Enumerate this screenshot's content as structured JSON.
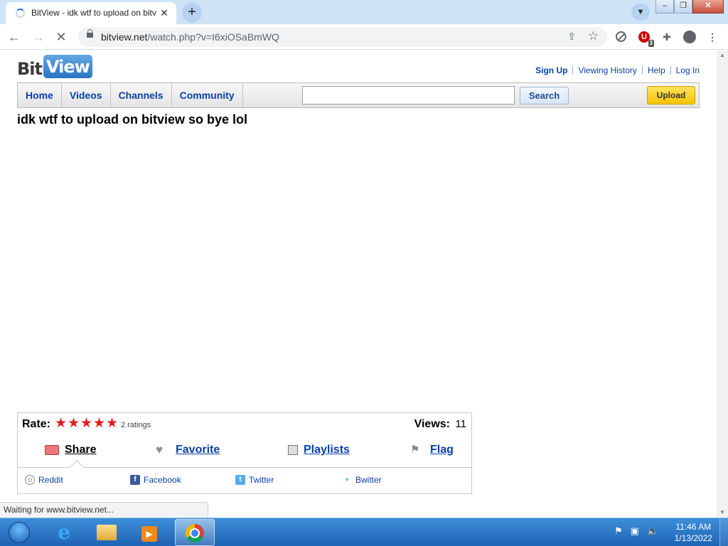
{
  "browser": {
    "tab_title": "BitView - idk wtf to upload on bitview so bye lol",
    "tab_close": "✕",
    "new_tab": "+",
    "url_host": "bitview.net",
    "url_path": "/watch.php?v=I6xiOSaBmWQ",
    "status_text": "Waiting for www.bitview.net...",
    "ublock_badge": "3"
  },
  "site": {
    "logo_bit": "Bit",
    "logo_view": "View",
    "top_links": [
      "Sign Up",
      "Viewing History",
      "Help",
      "Log In"
    ],
    "nav_items": [
      "Home",
      "Videos",
      "Channels",
      "Community"
    ],
    "search_value": "",
    "search_button": "Search",
    "upload_button": "Upload"
  },
  "video": {
    "title": "idk wtf to upload on bitview so bye lol",
    "rate_label": "Rate:",
    "stars": 5,
    "ratings_text": "2 ratings",
    "views_label": "Views:",
    "views_value": "11",
    "actions": [
      "Share",
      "Favorite",
      "Playlists",
      "Flag"
    ],
    "share_targets": [
      "Reddit",
      "Facebook",
      "Twitter",
      "Bwitter"
    ]
  },
  "taskbar": {
    "time": "11:46 AM",
    "date": "1/13/2022"
  },
  "colors": {
    "link_blue": "#0b3fa8",
    "star_red": "#e11a1a",
    "upload_yellow": "#f5c400",
    "taskbar_blue": "#1e63b5"
  }
}
